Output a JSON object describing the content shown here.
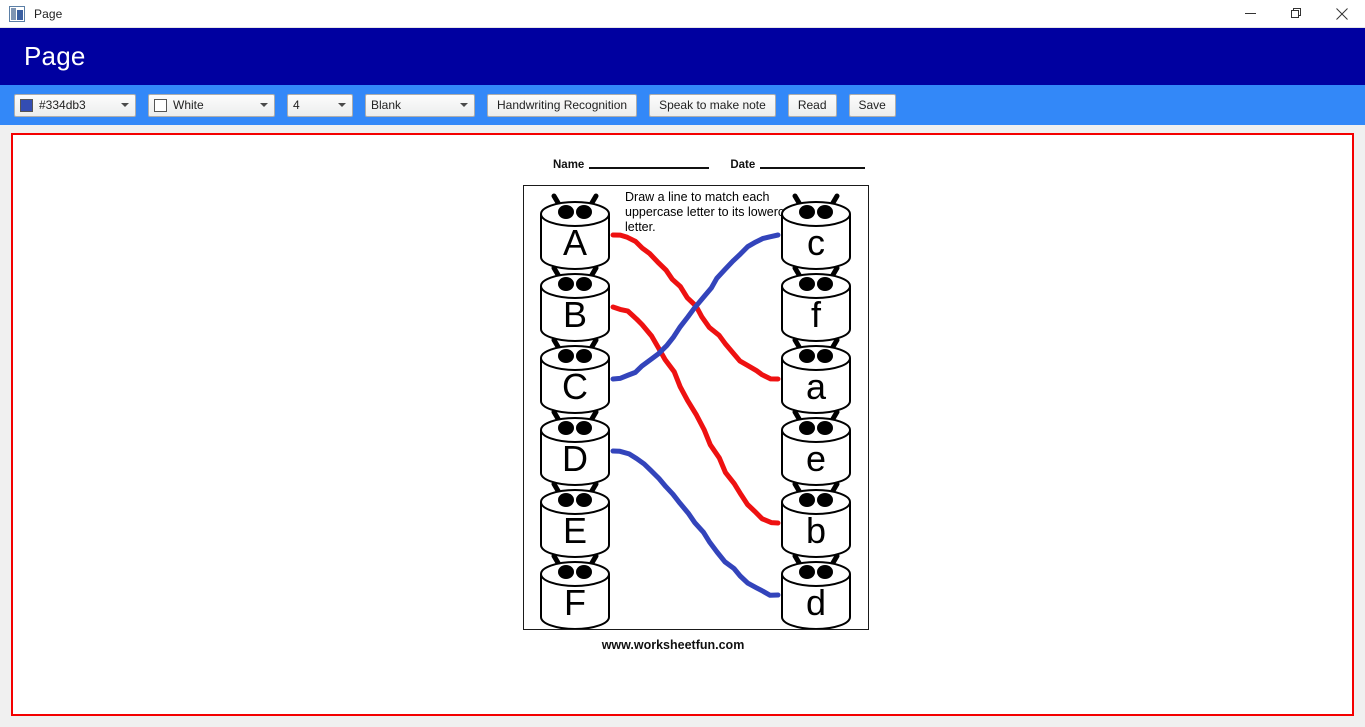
{
  "window": {
    "title": "Page",
    "icon": "app-icon",
    "controls": {
      "minimize": "minimize-icon",
      "restore": "restore-icon",
      "close": "close-icon"
    }
  },
  "header": {
    "title": "Page",
    "bg_color": "#0000a0",
    "text_color": "#ffffff"
  },
  "toolbar": {
    "bg_color": "#3388f8",
    "pen_color": {
      "label": "#334db3",
      "swatch": "#334db3"
    },
    "background_color": {
      "label": "White",
      "swatch": "#ffffff"
    },
    "pen_size": {
      "label": "4"
    },
    "page_style": {
      "label": "Blank"
    },
    "handwriting_button": "Handwriting Recognition",
    "speak_button": "Speak to make note",
    "read_button": "Read",
    "save_button": "Save"
  },
  "canvas": {
    "border_color": "#f40000",
    "bg_color": "#ffffff"
  },
  "worksheet": {
    "name_label": "Name",
    "date_label": "Date",
    "instructions": "Draw a line to match each uppercase letter to its lowercase letter.",
    "footer": "www.worksheetfun.com",
    "left_column": [
      "A",
      "B",
      "C",
      "D",
      "E",
      "F"
    ],
    "right_column": [
      "c",
      "f",
      "a",
      "e",
      "b",
      "d"
    ],
    "drawn_lines": [
      {
        "from": "A",
        "to": "a",
        "color": "#ee1111"
      },
      {
        "from": "B",
        "to": "b",
        "color": "#ee1111"
      },
      {
        "from": "C",
        "to": "c",
        "color": "#3344bb"
      },
      {
        "from": "D",
        "to": "d",
        "color": "#3344bb"
      }
    ]
  }
}
